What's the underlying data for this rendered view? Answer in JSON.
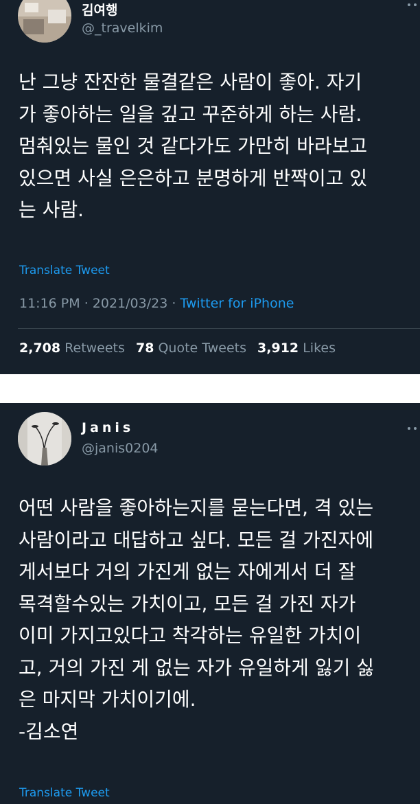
{
  "tweets": [
    {
      "display_name": "김여행",
      "handle": "@_travelkim",
      "avatar_icon": "profile-photo",
      "more_icon": "more-dots-icon",
      "text_lines": [
        "난 그냥 잔잔한 물결같은 사람이 좋아. 자기",
        "가 좋아하는 일을 깊고 꾸준하게 하는 사람.",
        "멈춰있는 물인 것 같다가도 가만히 바라보고",
        "있으면 사실 은은하고 분명하게 반짝이고 있",
        "는 사람."
      ],
      "translate_label": "Translate Tweet",
      "time": "11:16 PM",
      "separator": " · ",
      "date": "2021/03/23",
      "source": "Twitter for iPhone",
      "stats": {
        "retweets_count": "2,708",
        "retweets_label": "Retweets",
        "quotes_count": "78",
        "quotes_label": "Quote Tweets",
        "likes_count": "3,912",
        "likes_label": "Likes"
      }
    },
    {
      "display_name": "Janis",
      "handle": "@janis0204",
      "avatar_icon": "profile-photo-vase",
      "more_icon": "more-dots-icon",
      "text_lines": [
        "어떤 사람을 좋아하는지를 묻는다면, 격 있는",
        "사람이라고 대답하고 싶다. 모든 걸 가진자에",
        "게서보다 거의 가진게 없는 자에게서 더 잘",
        "목격할수있는 가치이고, 모든 걸 가진 자가",
        "이미 가지고있다고 착각하는 유일한 가치이",
        "고, 거의 가진 게 없는 자가 유일하게 잃기 싫",
        "은 마지막 가치이기에.",
        "-김소연"
      ],
      "translate_label": "Translate Tweet"
    }
  ],
  "colors": {
    "background": "#16202b",
    "text": "#ffffff",
    "secondary": "#8899a6",
    "link": "#1d9bf0",
    "divider": "#38444d",
    "gap": "#ffffff"
  }
}
